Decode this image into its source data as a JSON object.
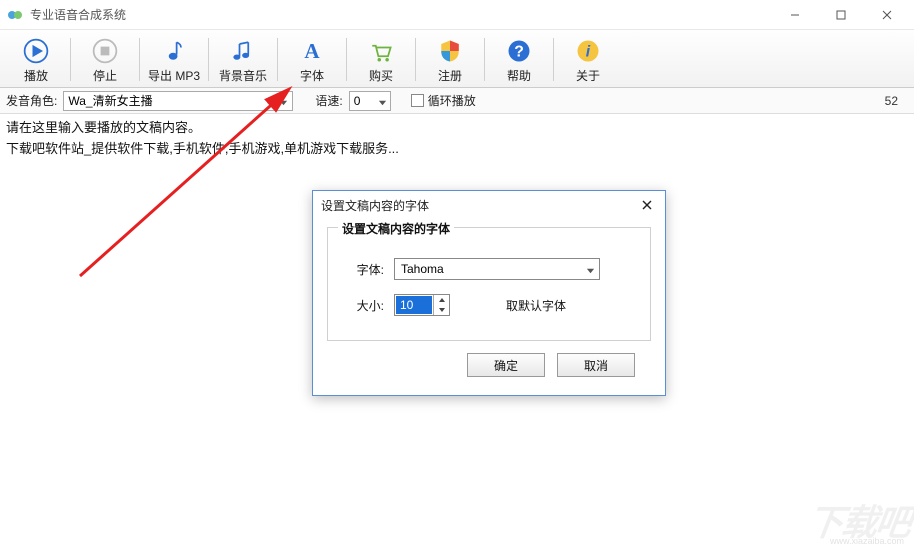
{
  "window": {
    "title": "专业语音合成系统"
  },
  "toolbar": {
    "play": "播放",
    "stop": "停止",
    "export": "导出 MP3",
    "bgm": "背景音乐",
    "font": "字体",
    "buy": "购买",
    "register": "注册",
    "help": "帮助",
    "about": "关于"
  },
  "options": {
    "role_label": "发音角色:",
    "role_value": "Wa_清新女主播",
    "speed_label": "语速:",
    "speed_value": "0",
    "loop_label": "循环播放",
    "counter": "52"
  },
  "editor": {
    "line1": "请在这里输入要播放的文稿内容。",
    "line2": "下载吧软件站_提供软件下载,手机软件,手机游戏,单机游戏下载服务..."
  },
  "dialog": {
    "title": "设置文稿内容的字体",
    "group_title": "设置文稿内容的字体",
    "font_label": "字体:",
    "font_value": "Tahoma",
    "size_label": "大小:",
    "size_value": "10",
    "default_link": "取默认字体",
    "ok": "确定",
    "cancel": "取消"
  },
  "watermark": {
    "big": "下载吧",
    "url": "www.xiazaiba.com"
  }
}
